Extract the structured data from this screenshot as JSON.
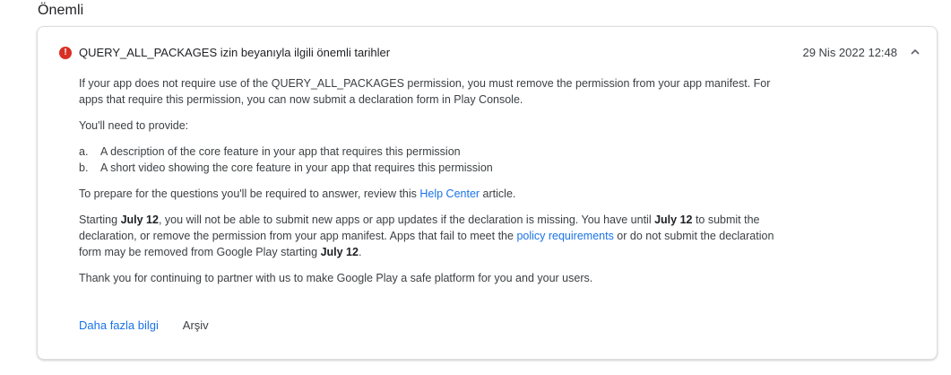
{
  "section": {
    "title": "Önemli"
  },
  "message": {
    "title": "QUERY_ALL_PACKAGES izin beyanıyla ilgili önemli tarihler",
    "date": "29 Nis 2022 12:48",
    "alert_icon": "!",
    "p1": "If your app does not require use of the QUERY_ALL_PACKAGES permission, you must remove the permission from your app manifest. For apps that require this permission, you can now submit a declaration form in Play Console.",
    "p2": "You'll need to provide:",
    "list": [
      {
        "mark": "a.",
        "text": "A description of the core feature in your app that requires this permission"
      },
      {
        "mark": "b.",
        "text": "A short video showing the core feature in your app that requires this permission"
      }
    ],
    "p3_before": "To prepare for the questions you'll be required to answer, review this ",
    "p3_link": "Help Center",
    "p3_after": " article.",
    "p4_a": "Starting ",
    "p4_b": "July 12",
    "p4_c": ", you will not be able to submit new apps or app updates if the declaration is missing. You have until ",
    "p4_d": "July 12",
    "p4_e": " to submit the declaration, or remove the permission from your app manifest. Apps that fail to meet the ",
    "p4_link": "policy requirements",
    "p4_f": " or do not submit the declaration form may be removed from Google Play starting ",
    "p4_g": "July 12",
    "p4_h": ".",
    "p5": "Thank you for continuing to partner with us to make Google Play a safe platform for you and your users."
  },
  "actions": {
    "more_label": "Daha fazla bilgi",
    "archive_label": "Arşiv"
  },
  "icons": {
    "alert": "error-circle-icon",
    "collapse": "chevron-up-icon"
  },
  "colors": {
    "accent": "#1a73e8",
    "error": "#d93025"
  }
}
